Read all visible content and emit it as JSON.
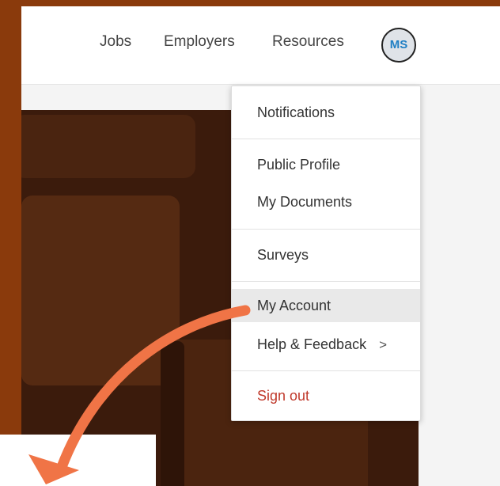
{
  "nav": {
    "items": [
      {
        "label": "Jobs"
      },
      {
        "label": "Employers"
      },
      {
        "label": "Resources"
      }
    ],
    "avatar_initials": "MS"
  },
  "menu": {
    "items": [
      {
        "label": "Notifications"
      },
      {
        "label": "Public Profile"
      },
      {
        "label": "My Documents"
      },
      {
        "label": "Surveys"
      },
      {
        "label": "My Account",
        "active": true
      },
      {
        "label": "Help & Feedback",
        "has_submenu": true
      },
      {
        "label": "Sign out"
      }
    ],
    "submenu_chevron": ">"
  },
  "colors": {
    "frame": "#8a3a0c",
    "avatar_text": "#1f7fc4",
    "sign_out": "#c0392b",
    "annotation_arrow": "#f07446",
    "highlight": "#e9e9e9"
  }
}
